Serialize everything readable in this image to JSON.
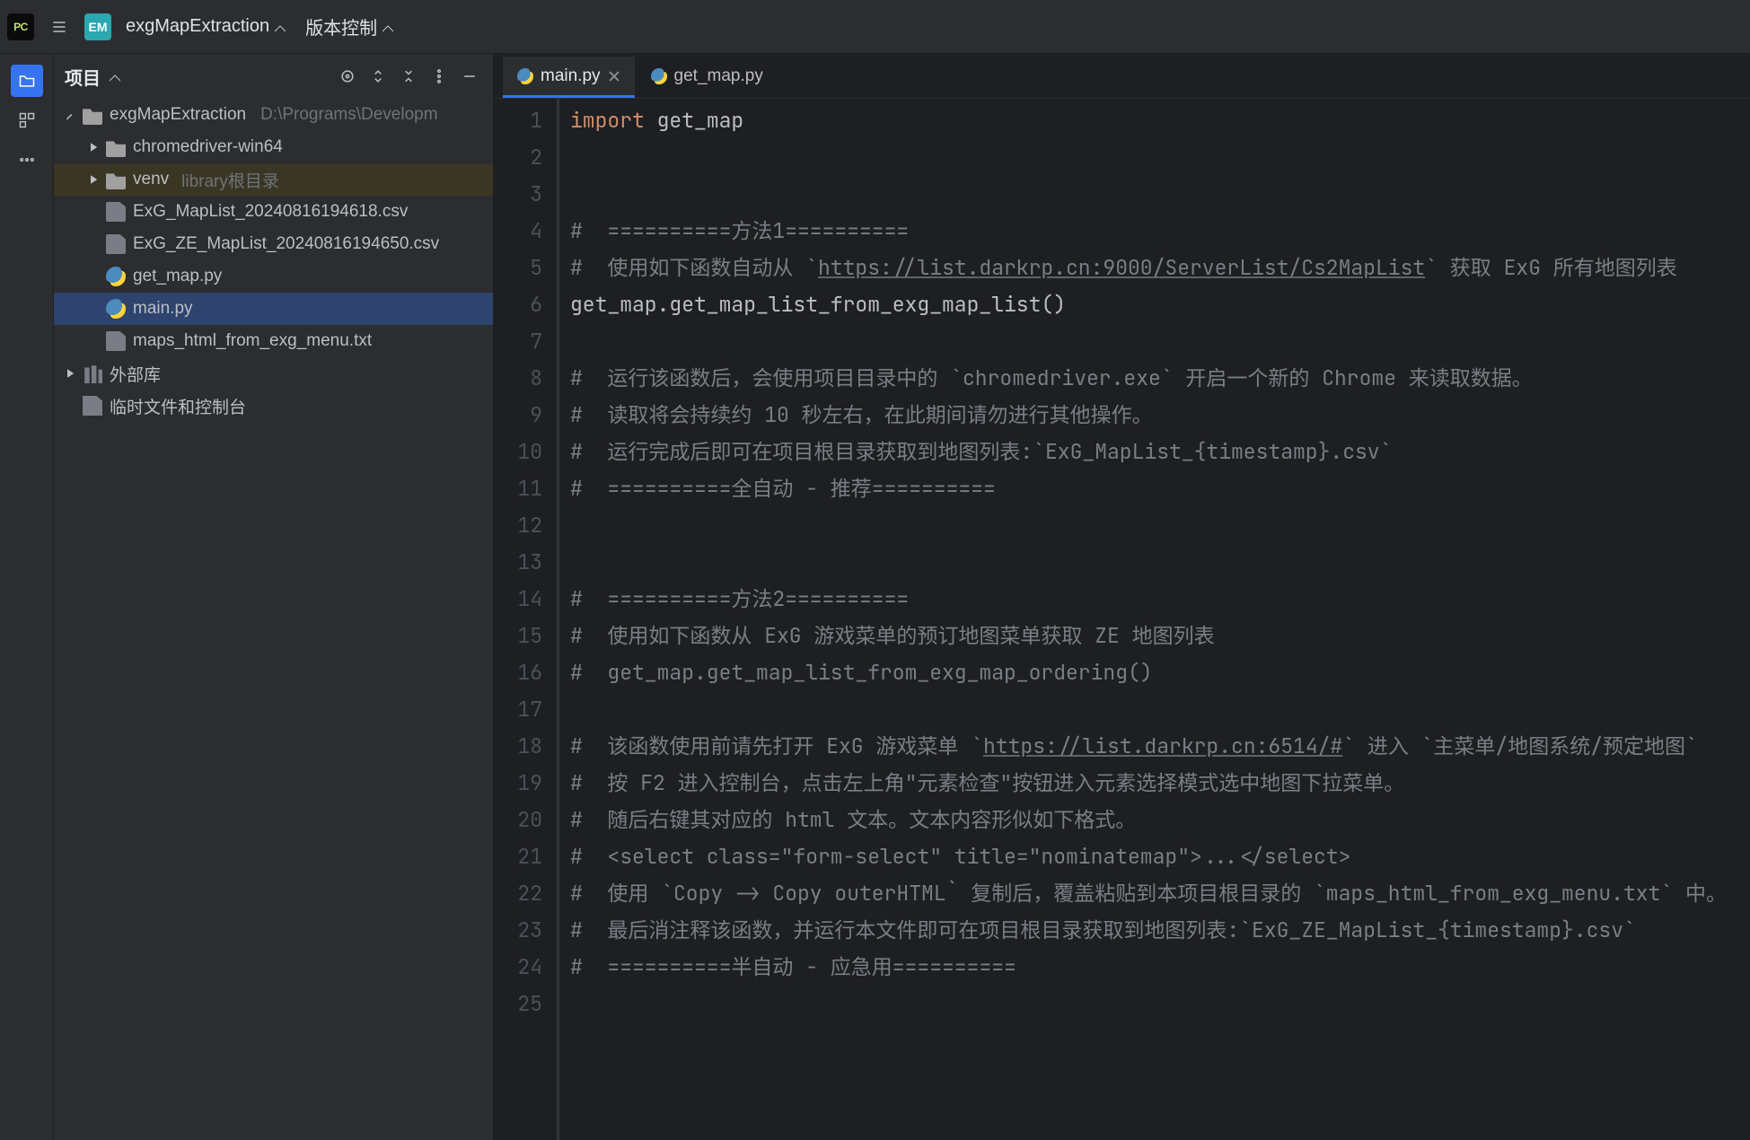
{
  "titlebar": {
    "project_badge": "EM",
    "project_name": "exgMapExtraction",
    "menu_version_control": "版本控制"
  },
  "toolwin": {
    "title": "项目"
  },
  "tree": {
    "root_name": "exgMapExtraction",
    "root_path": "D:\\Programs\\Developm",
    "folders": [
      {
        "name": "chromedriver-win64"
      },
      {
        "name": "venv",
        "hint": "library根目录"
      }
    ],
    "files": [
      {
        "name": "ExG_MapList_20240816194618.csv",
        "type": "file"
      },
      {
        "name": "ExG_ZE_MapList_20240816194650.csv",
        "type": "file"
      },
      {
        "name": "get_map.py",
        "type": "python"
      },
      {
        "name": "main.py",
        "type": "python",
        "selected": true
      },
      {
        "name": "maps_html_from_exg_menu.txt",
        "type": "file"
      }
    ],
    "external_libs": "外部库",
    "scratches": "临时文件和控制台"
  },
  "tabs": [
    {
      "label": "main.py",
      "type": "python",
      "active": true,
      "closable": true
    },
    {
      "label": "get_map.py",
      "type": "python",
      "active": false,
      "closable": false
    }
  ],
  "code": {
    "lines": [
      {
        "n": 1,
        "kind": "code",
        "pre_kw": "",
        "kw": "import",
        "post_kw": " get_map"
      },
      {
        "n": 2,
        "kind": "blank"
      },
      {
        "n": 3,
        "kind": "blank"
      },
      {
        "n": 4,
        "kind": "comment",
        "text": "#  ==========方法1=========="
      },
      {
        "n": 5,
        "kind": "comment_link",
        "before": "#  使用如下函数自动从 `",
        "link": "https://list.darkrp.cn:9000/ServerList/Cs2MapList",
        "after": "` 获取 ExG 所有地图列表"
      },
      {
        "n": 6,
        "kind": "plain",
        "text": "get_map.get_map_list_from_exg_map_list()"
      },
      {
        "n": 7,
        "kind": "blank"
      },
      {
        "n": 8,
        "kind": "comment",
        "text": "#  运行该函数后，会使用项目目录中的 `chromedriver.exe` 开启一个新的 Chrome 来读取数据。"
      },
      {
        "n": 9,
        "kind": "comment",
        "text": "#  读取将会持续约 10 秒左右，在此期间请勿进行其他操作。"
      },
      {
        "n": 10,
        "kind": "comment",
        "text": "#  运行完成后即可在项目根目录获取到地图列表:`ExG_MapList_{timestamp}.csv`"
      },
      {
        "n": 11,
        "kind": "comment",
        "text": "#  ==========全自动 - 推荐=========="
      },
      {
        "n": 12,
        "kind": "blank"
      },
      {
        "n": 13,
        "kind": "blank"
      },
      {
        "n": 14,
        "kind": "comment",
        "text": "#  ==========方法2=========="
      },
      {
        "n": 15,
        "kind": "comment",
        "text": "#  使用如下函数从 ExG 游戏菜单的预订地图菜单获取 ZE 地图列表"
      },
      {
        "n": 16,
        "kind": "comment",
        "text": "#  get_map.get_map_list_from_exg_map_ordering()"
      },
      {
        "n": 17,
        "kind": "blank"
      },
      {
        "n": 18,
        "kind": "comment_link",
        "before": "#  该函数使用前请先打开 ExG 游戏菜单 `",
        "link": "https://list.darkrp.cn:6514/#",
        "after": "` 进入 `主菜单/地图系统/预定地图`"
      },
      {
        "n": 19,
        "kind": "comment",
        "text": "#  按 F2 进入控制台，点击左上角\"元素检查\"按钮进入元素选择模式选中地图下拉菜单。"
      },
      {
        "n": 20,
        "kind": "comment",
        "text": "#  随后右键其对应的 html 文本。文本内容形似如下格式。"
      },
      {
        "n": 21,
        "kind": "comment",
        "text": "#  <select class=\"form-select\" title=\"nominatemap\">...</select>"
      },
      {
        "n": 22,
        "kind": "comment",
        "text": "#  使用 `Copy -> Copy outerHTML` 复制后，覆盖粘贴到本项目根目录的 `maps_html_from_exg_menu.txt` 中。"
      },
      {
        "n": 23,
        "kind": "comment",
        "text": "#  最后消注释该函数，并运行本文件即可在项目根目录获取到地图列表:`ExG_ZE_MapList_{timestamp}.csv`"
      },
      {
        "n": 24,
        "kind": "comment",
        "text": "#  ==========半自动 - 应急用=========="
      },
      {
        "n": 25,
        "kind": "blank"
      }
    ]
  }
}
